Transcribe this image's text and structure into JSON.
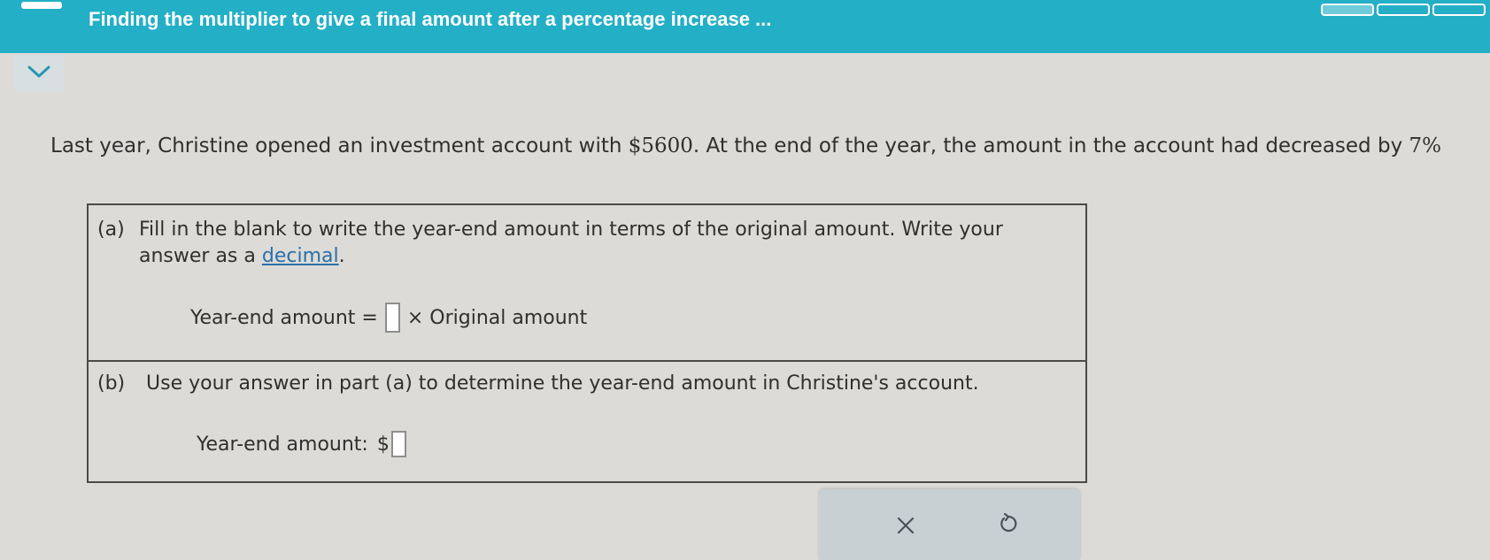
{
  "header": {
    "title": "Finding the multiplier to give a final amount after a percentage increase ...",
    "progress_segments": 3,
    "accent_color": "#23afc6"
  },
  "problem": {
    "text_before": "Last year, Christine opened an investment account with ",
    "amount": "$5600",
    "text_after": ". At the end of the year, the amount in the account had decreased by ",
    "percent": "7%"
  },
  "part_a": {
    "label": "(a)",
    "instruction_before": "Fill in the blank to write the year-end amount in terms of the original amount. Write your answer as a ",
    "link_text": "decimal",
    "instruction_after": ".",
    "equation_left": "Year-end amount =",
    "answer_value": "",
    "equation_right": "× Original amount"
  },
  "part_b": {
    "label": "(b)",
    "instruction": "Use your answer in part (a) to determine the year-end amount in Christine's account.",
    "answer_label": "Year-end amount:",
    "currency": "$",
    "answer_value": ""
  },
  "actions": {
    "clear_icon": "close-icon",
    "undo_icon": "undo-icon"
  }
}
